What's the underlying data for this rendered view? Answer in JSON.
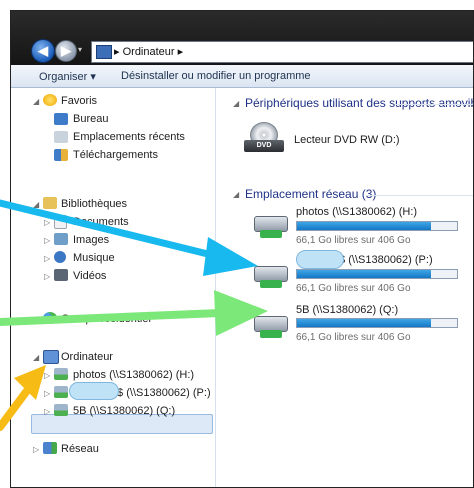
{
  "window": {
    "breadcrumb": [
      "Ordinateur"
    ],
    "sep": "▸"
  },
  "toolbar": {
    "organize": "Organiser ▾",
    "uninstall": "Désinstaller ou modifier un programme"
  },
  "nav": {
    "favorites": {
      "label": "Favoris",
      "items": [
        "Bureau",
        "Emplacements récents",
        "Téléchargements"
      ]
    },
    "libraries": {
      "label": "Bibliothèques",
      "items": [
        "Documents",
        "Images",
        "Musique",
        "Vidéos"
      ]
    },
    "homegroup": "Groupe résidentiel",
    "computer": {
      "label": "Ordinateur",
      "items": [
        "photos (\\\\S1380062) (H:)",
        "t$ (\\\\S1380062) (P:)",
        "5B (\\\\S1380062) (Q:)"
      ]
    },
    "network": "Réseau"
  },
  "content": {
    "removable_group": "Périphériques utilisant des supports amovibles",
    "dvd": "Lecteur DVD RW (D:)",
    "network_group": "Emplacement réseau (3)",
    "drives": [
      {
        "name": "photos (\\\\S1380062) (H:)",
        "free": "66,1 Go libres sur 406 Go",
        "used_fraction": 0.84
      },
      {
        "name": "t$ (\\\\S1380062) (P:)",
        "free": "66,1 Go libres sur 406 Go",
        "used_fraction": 0.84
      },
      {
        "name": "5B (\\\\S1380062) (Q:)",
        "free": "66,1 Go libres sur 406 Go",
        "used_fraction": 0.84
      }
    ]
  },
  "colors": {
    "arrow_blue": "#18b9ee",
    "arrow_green": "#7de87a",
    "arrow_yellow": "#f7bb16"
  }
}
